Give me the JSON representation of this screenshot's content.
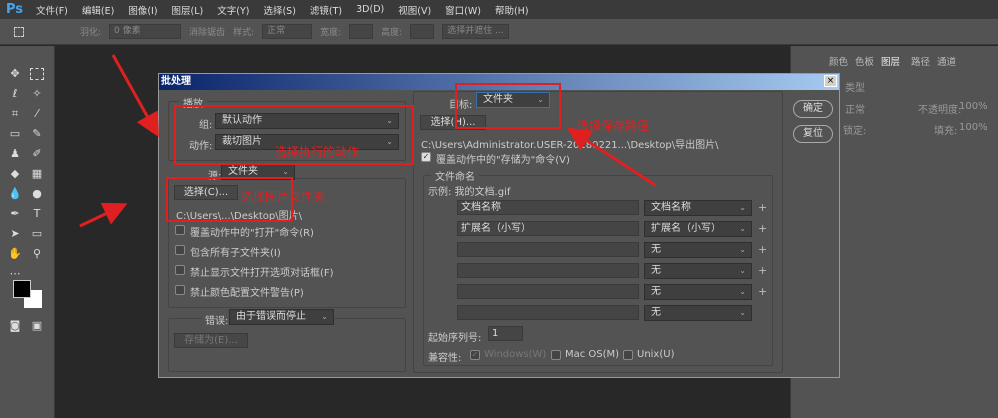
{
  "app": {
    "logo": "Ps",
    "menu": [
      "文件(F)",
      "编辑(E)",
      "图像(I)",
      "图层(L)",
      "文字(Y)",
      "选择(S)",
      "滤镜(T)",
      "3D(D)",
      "视图(V)",
      "窗口(W)",
      "帮助(H)"
    ]
  },
  "options": {
    "feather_label": "羽化:",
    "feather_value": "0 像素",
    "antialias": "消除锯齿",
    "style_label": "样式:",
    "style_value": "正常",
    "width_label": "宽度:",
    "height_label": "高度:",
    "select_mask": "选择并遮住 ..."
  },
  "panel": {
    "tabs": [
      "颜色",
      "色板",
      "图层",
      "路径",
      "通道"
    ],
    "kind": "类型",
    "mode": "正常",
    "opacity_label": "不透明度:",
    "opacity": "100%",
    "lock_label": "锁定:",
    "fill_label": "填充:",
    "fill": "100%"
  },
  "dialog": {
    "title": "批处理",
    "close": "×",
    "ok": "确定",
    "reset": "复位",
    "play": {
      "legend": "播放",
      "group_label": "组:",
      "group_value": "默认动作",
      "action_label": "动作:",
      "action_value": "裁切图片"
    },
    "source": {
      "label": "源:",
      "value": "文件夹",
      "choose": "选择(C)...",
      "path": "C:\\Users\\...\\Desktop\\图片\\",
      "options": [
        "覆盖动作中的\"打开\"命令(R)",
        "包含所有子文件夹(I)",
        "禁止显示文件打开选项对话框(F)",
        "禁止颜色配置文件警告(P)"
      ]
    },
    "error": {
      "label": "错误:",
      "value": "由于错误而停止",
      "save_as": "存储为(E)..."
    },
    "dest": {
      "label": "目标:",
      "value": "文件夹",
      "choose": "选择(H)...",
      "path": "C:\\Users\\Administrator.USER-20180221...\\Desktop\\导出图片\\",
      "override": "覆盖动作中的\"存储为\"命令(V)"
    },
    "naming": {
      "legend": "文件命名",
      "example": "示例: 我的文档.gif",
      "rows": [
        {
          "text": "文档名称",
          "select": "文档名称"
        },
        {
          "text": "扩展名（小写）",
          "select": "扩展名（小写）"
        },
        {
          "text": "",
          "select": "无"
        },
        {
          "text": "",
          "select": "无"
        },
        {
          "text": "",
          "select": "无"
        },
        {
          "text": "",
          "select": "无"
        }
      ],
      "serial_label": "起始序列号:",
      "serial": "1",
      "compat_label": "兼容性:",
      "windows": "Windows(W)",
      "mac": "Mac OS(M)",
      "unix": "Unix(U)"
    }
  },
  "annotations": {
    "action": "选择执行的动作",
    "folder": "选择图片文件夹",
    "save": "选择保存路径"
  },
  "colors": {
    "annotation": "#e02020",
    "titlebar": "#0a246a"
  }
}
